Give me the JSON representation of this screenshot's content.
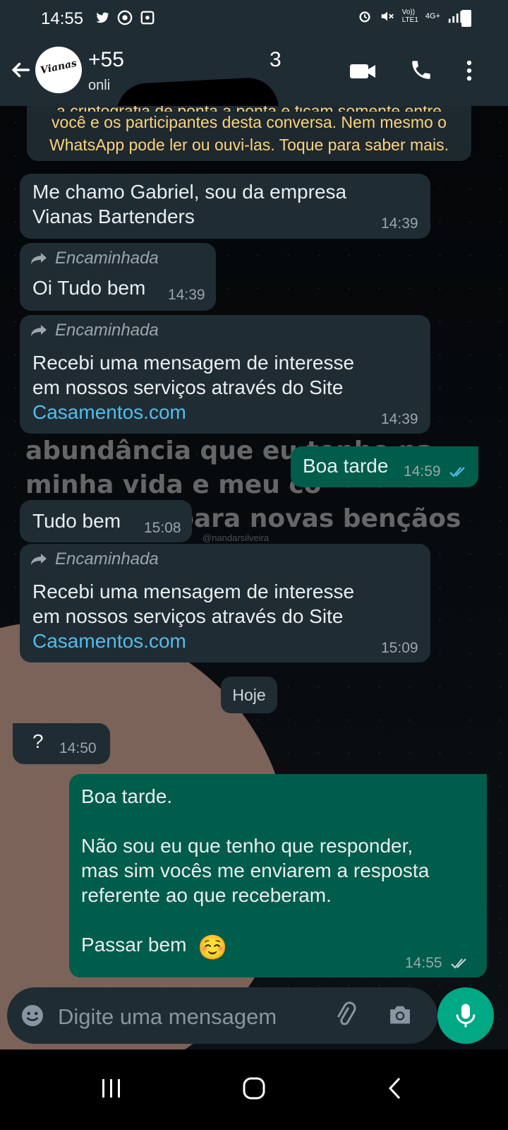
{
  "status_bar": {
    "time": "14:55",
    "net_volte": "Vo))",
    "net_lte": "LTE1",
    "net_4g": "4G+"
  },
  "header": {
    "contact_number_start": "+55",
    "contact_number_end": "3",
    "status": "onli",
    "avatar_text": "Vianas"
  },
  "encryption_notice": {
    "clipped": "a criptografia de ponta a ponta e ficam somente entre",
    "lines": [
      "você e os participantes desta conversa. Nem mesmo o",
      "WhatsApp pode ler ou ouvi-las. Toque para saber mais."
    ]
  },
  "wallpaper": {
    "caption": "abundância que eu tenho na\nminha vida e meu co\n                 para novas bençãos",
    "handle": "@nandarsilveira"
  },
  "messages": [
    {
      "text": "Me chamo Gabriel, sou da empresa\nVianas Bartenders",
      "time": "14:39"
    },
    {
      "forwarded": "Encaminhada",
      "text": "Oi Tudo bem",
      "time": "14:39"
    },
    {
      "forwarded": "Encaminhada",
      "text": "Recebi uma mensagem de interesse\nem nossos serviços através do Site",
      "link": "Casamentos.com",
      "time": "14:39"
    },
    {
      "text": "Boa tarde",
      "time": "14:59"
    },
    {
      "text": "Tudo bem",
      "time": "15:08"
    },
    {
      "forwarded": "Encaminhada",
      "text": "Recebi uma mensagem de interesse\nem nossos serviços através do Site",
      "link": "Casamentos.com",
      "time": "15:09"
    },
    {
      "text": "?",
      "time": "14:50"
    },
    {
      "text": "Boa tarde.\n\nNão sou eu que tenho que responder,\nmas sim vocês me enviarem a resposta\nreferente ao que receberam.\n\nPassar bem",
      "emoji": "☺️",
      "time": "14:55"
    }
  ],
  "date_divider": "Hoje",
  "input": {
    "placeholder": "Digite uma mensagem"
  },
  "icons": {
    "back": "arrow-left-icon",
    "video": "video-call-icon",
    "call": "phone-icon",
    "menu": "more-vert-icon",
    "emoji": "emoji-icon",
    "attach": "attach-icon",
    "camera": "camera-icon",
    "mic": "mic-icon",
    "forward": "forward-arrow-icon",
    "tick": "double-check-icon"
  },
  "colors": {
    "header": "#1f2c34",
    "incoming_bubble": "#1f2c34",
    "outgoing_bubble": "#005c4b",
    "link": "#53bdeb",
    "read_tick": "#53bdeb",
    "accent": "#00a884"
  }
}
